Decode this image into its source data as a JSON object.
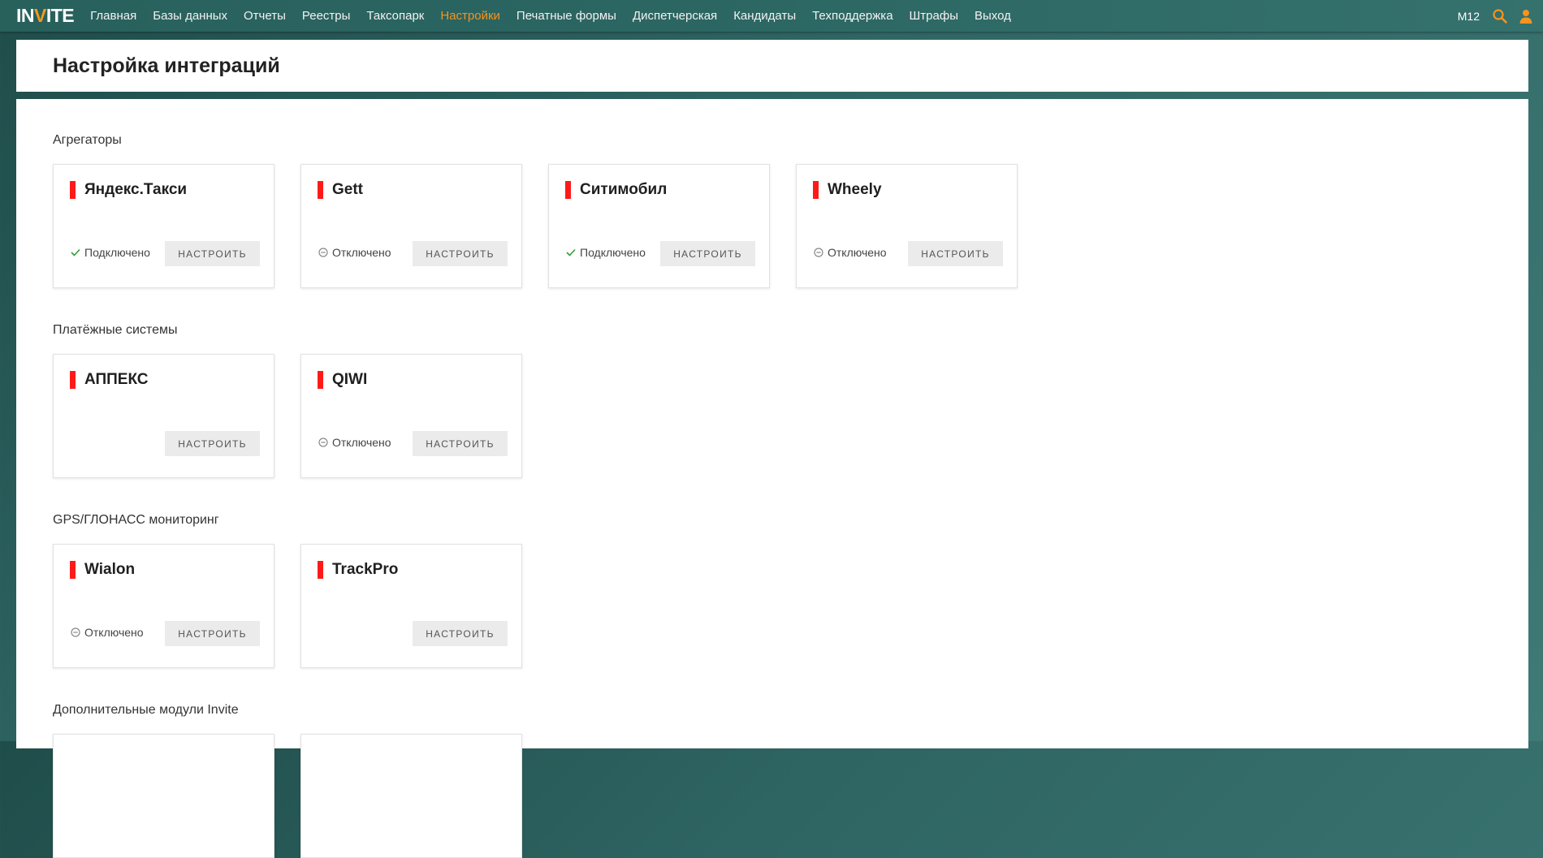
{
  "topbar": {
    "logo_part1": "IN",
    "logo_part2": "V",
    "logo_part3": "ITE",
    "nav": [
      {
        "label": "Главная"
      },
      {
        "label": "Базы данных"
      },
      {
        "label": "Отчеты"
      },
      {
        "label": "Реестры"
      },
      {
        "label": "Таксопарк"
      },
      {
        "label": "Настройки",
        "active": true
      },
      {
        "label": "Печатные формы"
      },
      {
        "label": "Диспетчерская"
      },
      {
        "label": "Кандидаты"
      },
      {
        "label": "Техподдержка"
      },
      {
        "label": "Штрафы"
      },
      {
        "label": "Выход"
      }
    ],
    "user_code": "М12",
    "icons": [
      "search-icon",
      "user-icon"
    ],
    "accent_color": "#f7931e"
  },
  "page": {
    "title": "Настройка интеграций"
  },
  "sections": {
    "aggregators": {
      "title": "Агрегаторы",
      "cards": [
        {
          "name": "Яндекс.Такси",
          "status": "Подключено",
          "button": "НАСТРОИТЬ"
        },
        {
          "name": "Gett",
          "status": "Отключено",
          "button": "НАСТРОИТЬ"
        },
        {
          "name": "Ситимобил",
          "status": "Подключено",
          "button": "НАСТРОИТЬ"
        },
        {
          "name": "Wheely",
          "status": "Отключено",
          "button": "НАСТРОИТЬ"
        }
      ]
    },
    "payments": {
      "title": "Платёжные системы",
      "cards": [
        {
          "name": "АППЕКС",
          "status": "",
          "button": "НАСТРОИТЬ"
        },
        {
          "name": "QIWI",
          "status": "Отключено",
          "button": "НАСТРОИТЬ"
        }
      ]
    },
    "gps": {
      "title": "GPS/ГЛОНАСС мониторинг",
      "cards": [
        {
          "name": "Wialon",
          "status": "Отключено",
          "button": "НАСТРОИТЬ"
        },
        {
          "name": "TrackPro",
          "status": "",
          "button": "НАСТРОИТЬ"
        }
      ]
    },
    "modules": {
      "title": "Дополнительные модули Invite"
    }
  },
  "colors": {
    "status_bar": "#ff1a1a",
    "connected": "#3a9a3a",
    "disconnected": "#888888"
  }
}
